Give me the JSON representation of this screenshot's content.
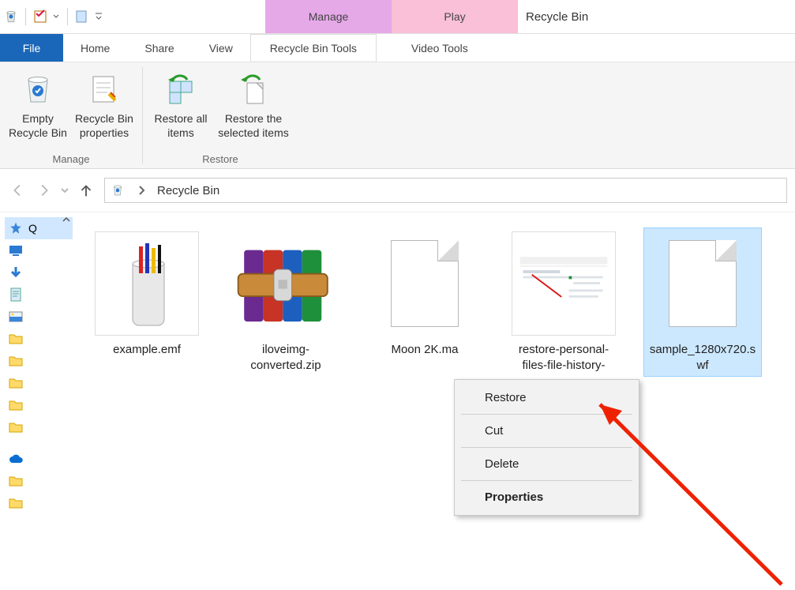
{
  "window": {
    "title": "Recycle Bin"
  },
  "context_tabs": {
    "manage": "Manage",
    "play": "Play"
  },
  "tabs": {
    "file": "File",
    "home": "Home",
    "share": "Share",
    "view": "View",
    "rbtools": "Recycle Bin Tools",
    "vtools": "Video Tools"
  },
  "ribbon": {
    "manage_group": "Manage",
    "restore_group": "Restore",
    "empty_label": "Empty Recycle Bin",
    "props_label": "Recycle Bin properties",
    "restore_all_label": "Restore all items",
    "restore_sel_label": "Restore the selected items"
  },
  "breadcrumb": {
    "location": "Recycle Bin"
  },
  "files": [
    {
      "name": "example.emf"
    },
    {
      "name": "iloveimg-converted.zip"
    },
    {
      "name": "Moon 2K.ma"
    },
    {
      "name": "restore-personal-files-file-history-"
    },
    {
      "name": "sample_1280x720.swf"
    }
  ],
  "sidebar": {
    "quickaccess_label": "Q"
  },
  "context_menu": {
    "restore": "Restore",
    "cut": "Cut",
    "delete": "Delete",
    "properties": "Properties"
  }
}
